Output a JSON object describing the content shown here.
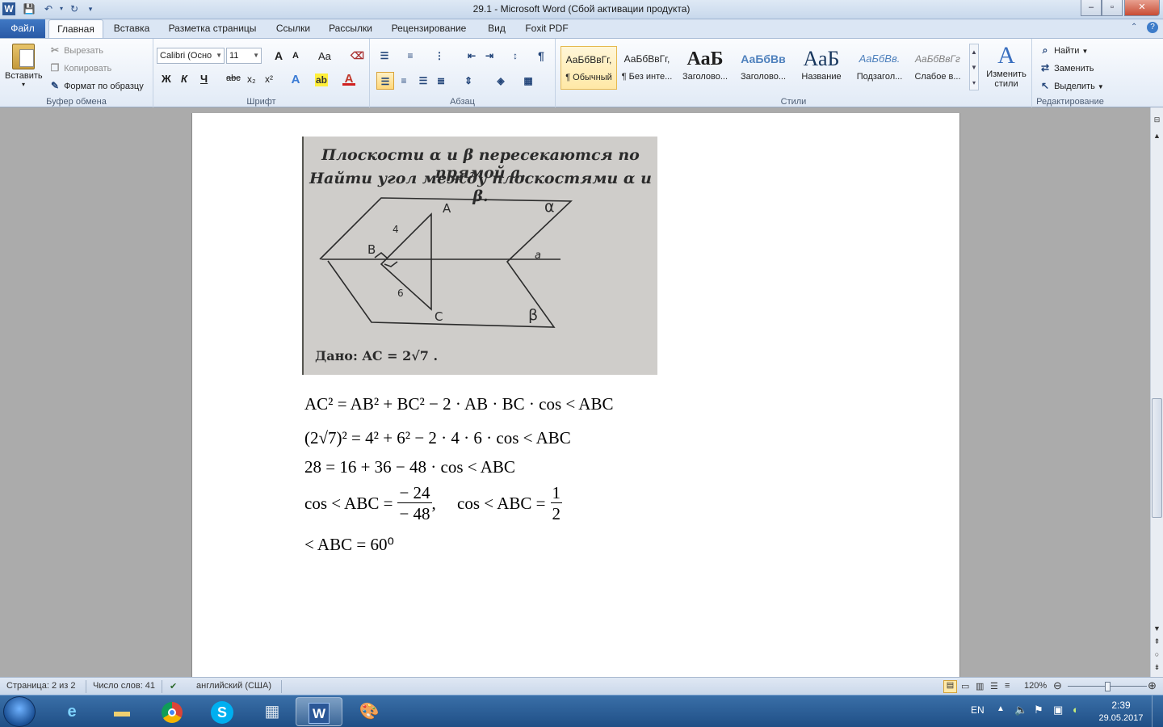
{
  "window": {
    "title": "29.1  -  Microsoft Word (Сбой активации продукта)",
    "buttons": {
      "minimize": "–",
      "maximize": "▫",
      "close": "✕"
    }
  },
  "quick_access": [
    "W",
    "save-icon",
    "undo-icon",
    "redo-icon"
  ],
  "tabs": {
    "file": "Файл",
    "items": [
      "Главная",
      "Вставка",
      "Разметка страницы",
      "Ссылки",
      "Рассылки",
      "Рецензирование",
      "Вид",
      "Foxit PDF"
    ],
    "active": "Главная"
  },
  "ribbon": {
    "clipboard": {
      "paste": "Вставить",
      "cut": "Вырезать",
      "copy": "Копировать",
      "format_painter": "Формат по образцу",
      "label": "Буфер обмена"
    },
    "font": {
      "font_name": "Calibri (Осно",
      "font_size": "11",
      "grow": "A",
      "shrink": "A",
      "case": "Aa",
      "bold": "Ж",
      "italic": "К",
      "underline": "Ч",
      "strike": "abc",
      "subscript": "x₂",
      "superscript": "x²",
      "label": "Шрифт"
    },
    "paragraph": {
      "label": "Абзац",
      "pilcrow": "¶"
    },
    "styles": {
      "items": [
        {
          "preview": "АаБбВвГг,",
          "name": "¶ Обычный"
        },
        {
          "preview": "АаБбВвГг,",
          "name": "¶ Без инте..."
        },
        {
          "preview": "АаБ",
          "name": "Заголово..."
        },
        {
          "preview": "АаБбВв",
          "name": "Заголово..."
        },
        {
          "preview": "АаБ",
          "name": "Название"
        },
        {
          "preview": "АаБбВв.",
          "name": "Подзагол..."
        },
        {
          "preview": "АаБбВвГг",
          "name": "Слабое в..."
        }
      ],
      "change": "Изменить стили",
      "label": "Стили"
    },
    "editing": {
      "find": "Найти",
      "replace": "Заменить",
      "select": "Выделить",
      "label": "Редактирование"
    }
  },
  "document": {
    "image_text": {
      "line1": "Плоскости α и β пересекаются по прямой a.",
      "line2": "Найти угол между плоскостями α и β.",
      "given": "Дано: AC = 2√7 .",
      "labels": {
        "A": "A",
        "B": "B",
        "C": "C",
        "alpha": "α",
        "beta": "β",
        "line_a": "a",
        "ab": "4",
        "bc": "6"
      }
    },
    "equations": {
      "eq1": "AC² = AB² + BC² − 2 · AB · BC · cos < ABC",
      "eq2": "(2√7)² = 4² + 6² − 2 · 4 · 6 · cos < ABC",
      "eq3": "28 = 16 + 36 − 48 · cos < ABC",
      "eq4_lhs": "cos < ABC =",
      "eq4_num": "− 24",
      "eq4_den": "− 48",
      "eq4_mid": ",     cos < ABC =",
      "eq4_num2": "1",
      "eq4_den2": "2",
      "eq5": "< ABC = 60⁰"
    }
  },
  "status": {
    "page": "Страница: 2 из 2",
    "words": "Число слов: 41",
    "language": "английский (США)",
    "zoom": "120%"
  },
  "taskbar": {
    "apps": [
      "internet-explorer",
      "file-explorer",
      "chrome",
      "skype",
      "calculator",
      "word",
      "paint"
    ],
    "lang": "EN",
    "time": "2:39",
    "date": "29.05.2017"
  }
}
